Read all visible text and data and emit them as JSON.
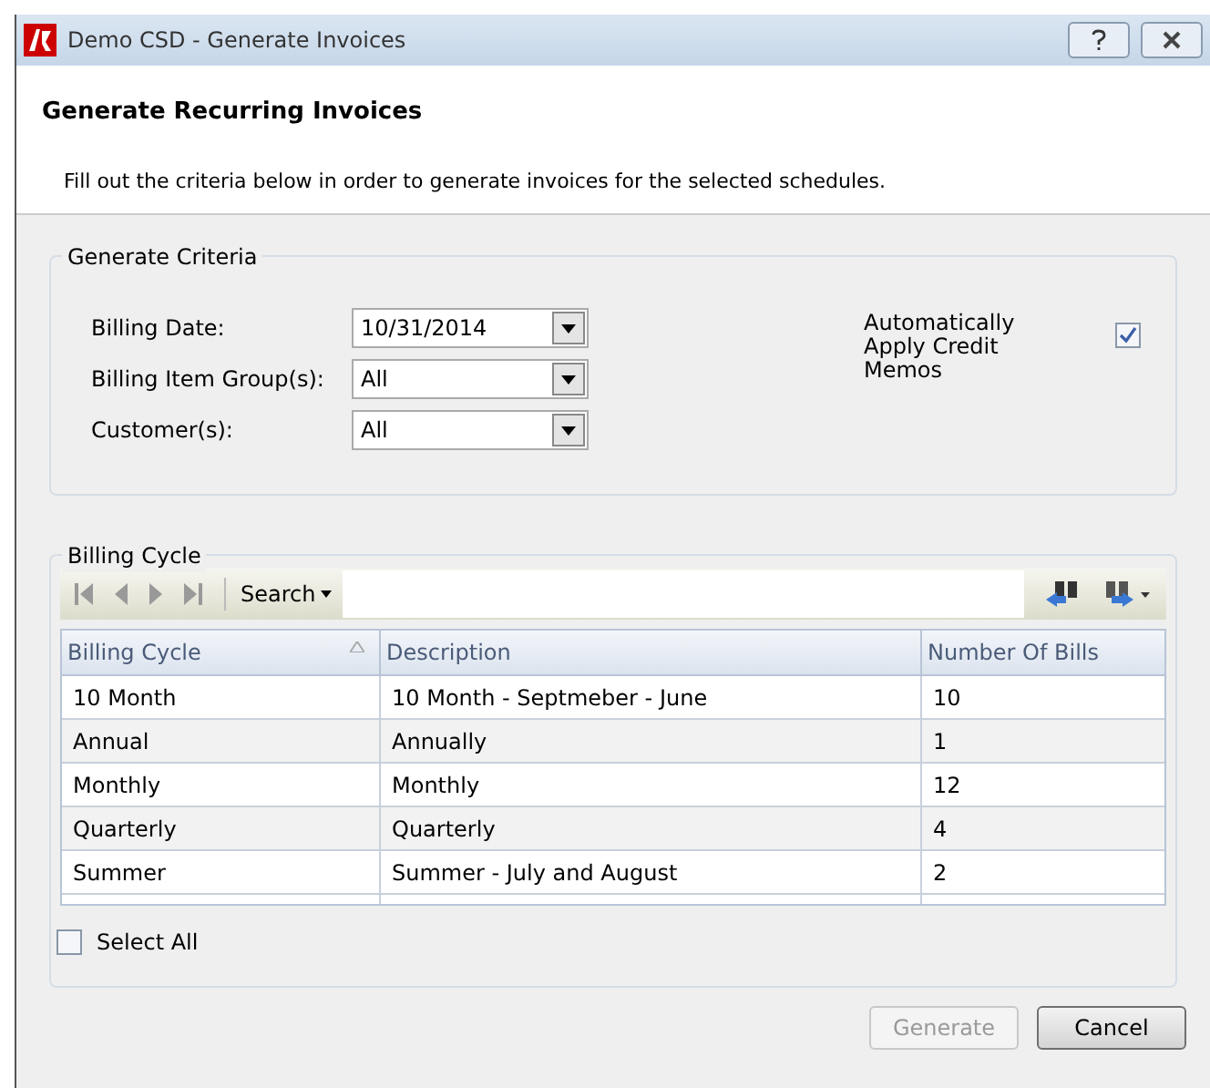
{
  "window": {
    "title": "Demo CSD - Generate Invoices"
  },
  "header": {
    "title": "Generate Recurring Invoices",
    "instructions": "Fill out the criteria below in order to generate invoices for the selected schedules."
  },
  "criteria": {
    "legend": "Generate Criteria",
    "fields": [
      {
        "label": "Billing Date:",
        "value": "10/31/2014"
      },
      {
        "label": "Billing Item Group(s):",
        "value": "All"
      },
      {
        "label": "Customer(s):",
        "value": "All"
      }
    ],
    "auto_apply": {
      "label": "Automatically Apply Credit Memos",
      "checked": true
    }
  },
  "billing_cycle": {
    "legend": "Billing Cycle",
    "search_label": "Search",
    "columns": [
      "Billing Cycle",
      "Description",
      "Number Of Bills"
    ],
    "rows": [
      [
        "10 Month",
        "10 Month - Septmeber - June",
        "10"
      ],
      [
        "Annual",
        "Annually",
        "1"
      ],
      [
        "Monthly",
        "Monthly",
        "12"
      ],
      [
        "Quarterly",
        "Quarterly",
        "4"
      ],
      [
        "Summer",
        "Summer - July and August",
        "2"
      ]
    ],
    "select_all": {
      "label": "Select All",
      "checked": false
    }
  },
  "buttons": [
    {
      "label": "Generate",
      "disabled": true
    },
    {
      "label": "Cancel",
      "disabled": false
    }
  ]
}
